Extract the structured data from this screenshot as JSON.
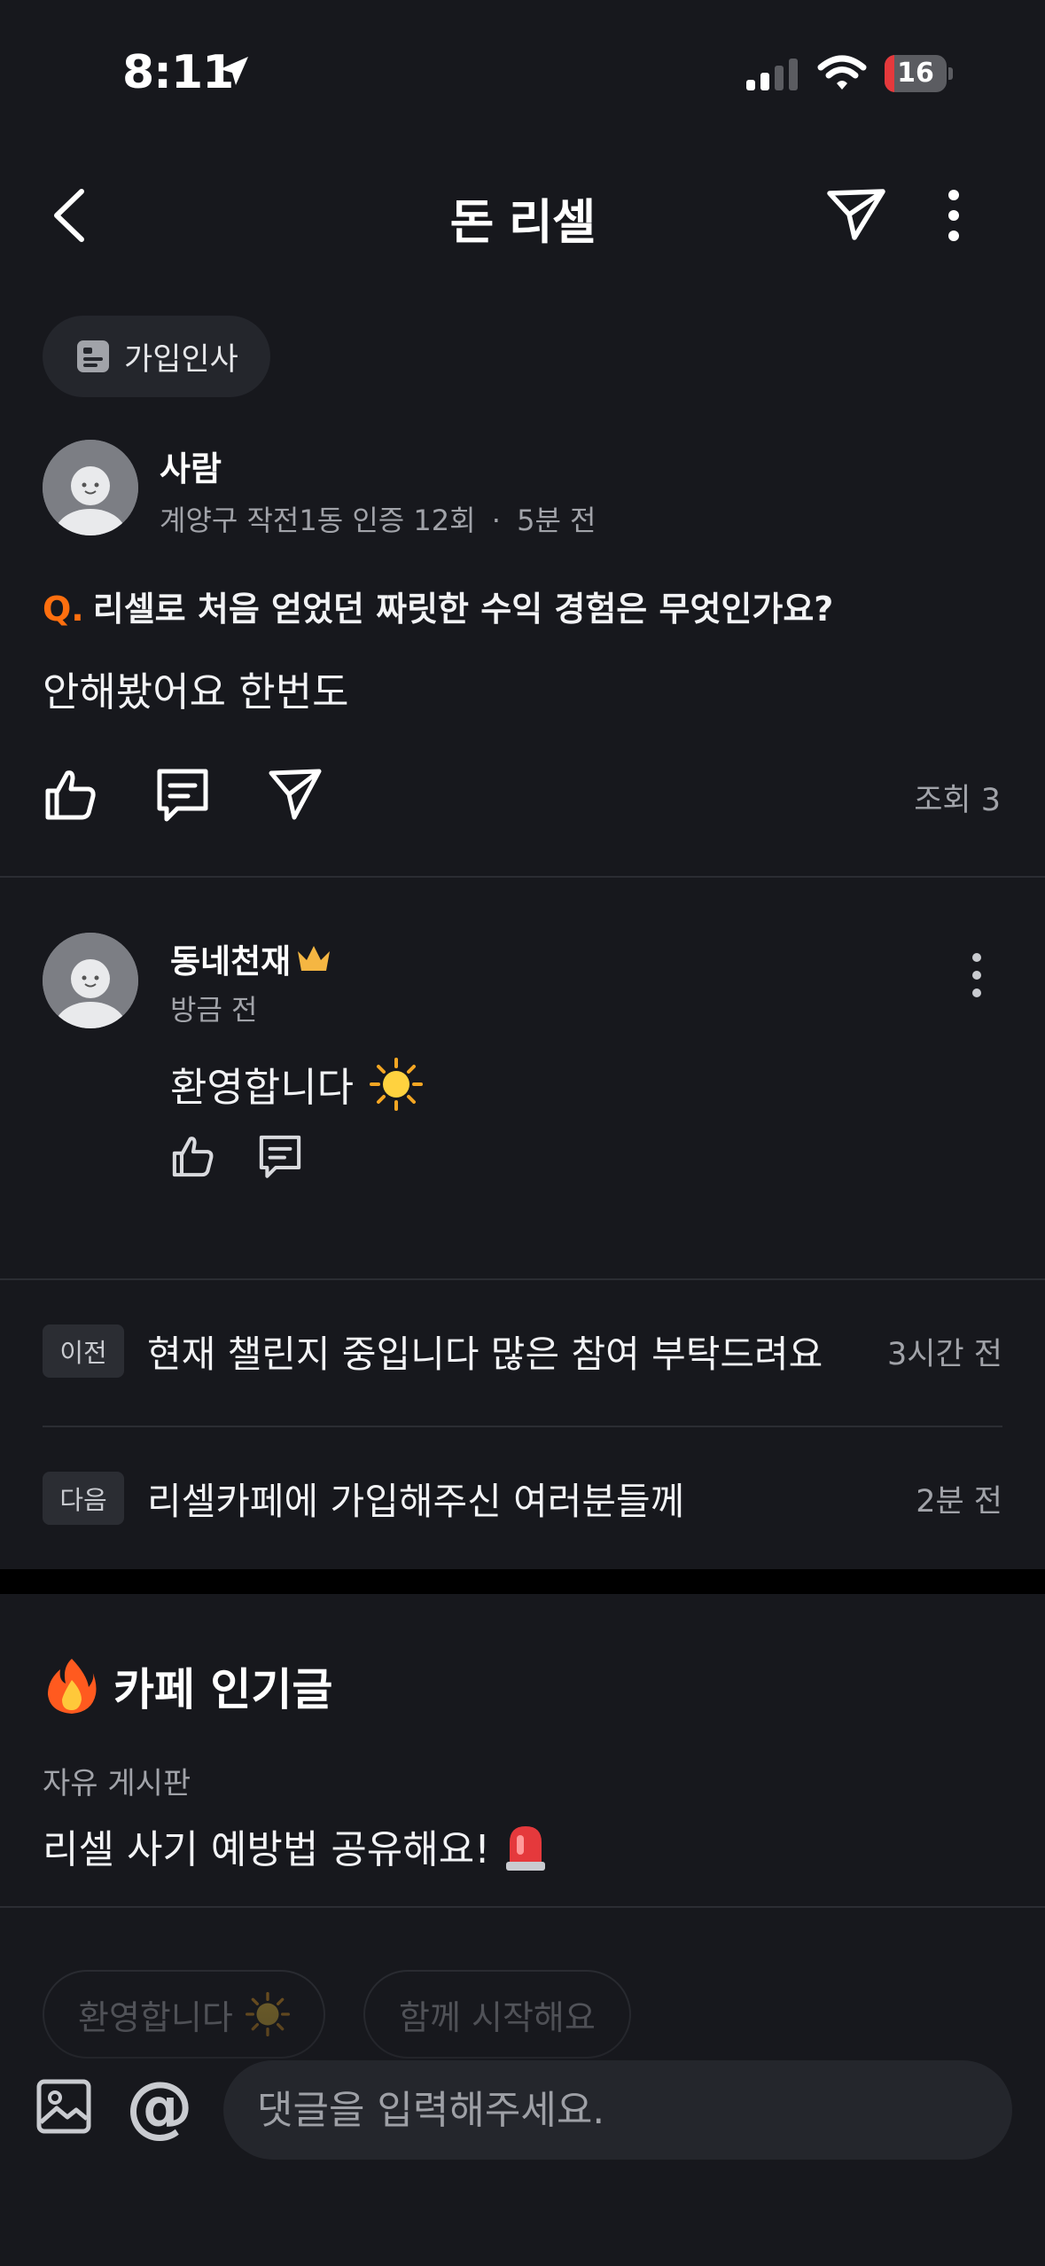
{
  "status_bar": {
    "time": "8:11",
    "battery_level": "16",
    "battery_color": "#e5393c"
  },
  "header": {
    "title": "돈 리셀",
    "back_icon": "chevron-left-icon",
    "share_icon": "paper-plane-icon",
    "more_icon": "vertical-dots-icon"
  },
  "post": {
    "category": "가입인사",
    "author": {
      "name": "사람",
      "location": "계양구 작전1동",
      "verification": "인증 12회",
      "separator": "·",
      "time": "5분 전"
    },
    "question_marker": "Q.",
    "question": "리셀로 처음 얻었던 짜릿한 수익 경험은 무엇인가요?",
    "body": "안해봤어요 한번도",
    "views": "조회 3"
  },
  "comment": {
    "author": "동네천재",
    "crown_icon": "crown-icon",
    "time": "방금 전",
    "text": "환영합니다",
    "emoji": "☀️"
  },
  "navigation": {
    "prev": {
      "badge": "이전",
      "title": "현재 챌린지 중입니다 많은 참여 부탁드려요",
      "time": "3시간 전"
    },
    "next": {
      "badge": "다음",
      "title": "리셀카페에 가입해주신 여러분들께",
      "time": "2분 전"
    }
  },
  "popular": {
    "emoji": "🔥",
    "title": "카페 인기글",
    "board": "자유 게시판",
    "post_title": "리셀 사기 예방법 공유해요!",
    "post_emoji": "🚨"
  },
  "quick_replies": [
    {
      "label": "환영합니다",
      "emoji": "☀️"
    },
    {
      "label": "함께 시작해요"
    }
  ],
  "input": {
    "placeholder": "댓글을 입력해주세요.",
    "mention_symbol": "@"
  },
  "colors": {
    "accent": "#ff6f0f",
    "background": "#17181d",
    "crown": "#f5b642"
  }
}
